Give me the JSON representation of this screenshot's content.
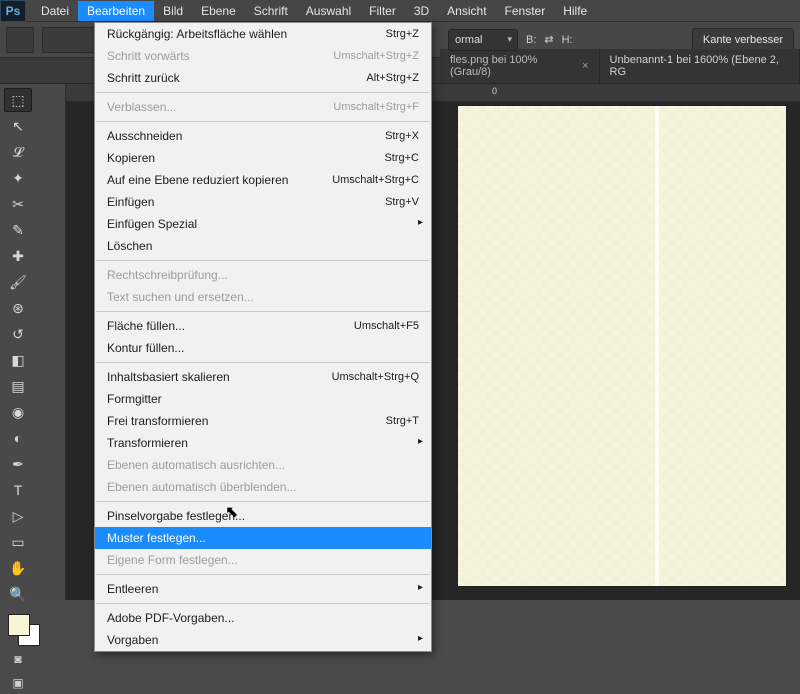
{
  "menubar": [
    "Datei",
    "Bearbeiten",
    "Bild",
    "Ebene",
    "Schrift",
    "Auswahl",
    "Filter",
    "3D",
    "Ansicht",
    "Fenster",
    "Hilfe"
  ],
  "menubar_open_index": 1,
  "options": {
    "style_value": "ormal",
    "b_label": "B:",
    "h_label": "H:",
    "refine_btn": "Kante verbesser"
  },
  "tabs": [
    {
      "label": "fles.png bei 100% (Grau/8)",
      "closable": true
    },
    {
      "label": "Unbenannt-1 bei 1600% (Ebene 2, RG",
      "closable": false
    }
  ],
  "ruler": {
    "tick0": "0"
  },
  "edit_menu": [
    {
      "t": "item",
      "label": "Rückgängig: Arbeitsfläche wählen",
      "shortcut": "Strg+Z"
    },
    {
      "t": "item",
      "label": "Schritt vorwärts",
      "shortcut": "Umschalt+Strg+Z",
      "disabled": true
    },
    {
      "t": "item",
      "label": "Schritt zurück",
      "shortcut": "Alt+Strg+Z"
    },
    {
      "t": "sep"
    },
    {
      "t": "item",
      "label": "Verblassen...",
      "shortcut": "Umschalt+Strg+F",
      "disabled": true
    },
    {
      "t": "sep"
    },
    {
      "t": "item",
      "label": "Ausschneiden",
      "shortcut": "Strg+X"
    },
    {
      "t": "item",
      "label": "Kopieren",
      "shortcut": "Strg+C"
    },
    {
      "t": "item",
      "label": "Auf eine Ebene reduziert kopieren",
      "shortcut": "Umschalt+Strg+C"
    },
    {
      "t": "item",
      "label": "Einfügen",
      "shortcut": "Strg+V"
    },
    {
      "t": "sub",
      "label": "Einfügen Spezial"
    },
    {
      "t": "item",
      "label": "Löschen"
    },
    {
      "t": "sep"
    },
    {
      "t": "item",
      "label": "Rechtschreibprüfung...",
      "disabled": true
    },
    {
      "t": "item",
      "label": "Text suchen und ersetzen...",
      "disabled": true
    },
    {
      "t": "sep"
    },
    {
      "t": "item",
      "label": "Fläche füllen...",
      "shortcut": "Umschalt+F5"
    },
    {
      "t": "item",
      "label": "Kontur füllen..."
    },
    {
      "t": "sep"
    },
    {
      "t": "item",
      "label": "Inhaltsbasiert skalieren",
      "shortcut": "Umschalt+Strg+Q"
    },
    {
      "t": "item",
      "label": "Formgitter"
    },
    {
      "t": "item",
      "label": "Frei transformieren",
      "shortcut": "Strg+T"
    },
    {
      "t": "sub",
      "label": "Transformieren"
    },
    {
      "t": "item",
      "label": "Ebenen automatisch ausrichten...",
      "disabled": true
    },
    {
      "t": "item",
      "label": "Ebenen automatisch überblenden...",
      "disabled": true
    },
    {
      "t": "sep"
    },
    {
      "t": "item",
      "label": "Pinselvorgabe festlegen..."
    },
    {
      "t": "item",
      "label": "Muster festlegen...",
      "highlight": true
    },
    {
      "t": "item",
      "label": "Eigene Form festlegen...",
      "disabled": true
    },
    {
      "t": "sep"
    },
    {
      "t": "sub",
      "label": "Entleeren"
    },
    {
      "t": "sep"
    },
    {
      "t": "item",
      "label": "Adobe PDF-Vorgaben..."
    },
    {
      "t": "sub",
      "label": "Vorgaben"
    }
  ],
  "tools": [
    {
      "name": "marquee-tool",
      "glyph": "⬚",
      "selected": true
    },
    {
      "name": "move-tool",
      "glyph": "↖"
    },
    {
      "name": "lasso-tool",
      "glyph": "𝓛"
    },
    {
      "name": "quick-select-tool",
      "glyph": "✦"
    },
    {
      "name": "crop-tool",
      "glyph": "✂"
    },
    {
      "name": "eyedropper-tool",
      "glyph": "✎"
    },
    {
      "name": "heal-tool",
      "glyph": "✚"
    },
    {
      "name": "brush-tool",
      "glyph": "🖌"
    },
    {
      "name": "stamp-tool",
      "glyph": "⊛"
    },
    {
      "name": "history-brush-tool",
      "glyph": "↺"
    },
    {
      "name": "eraser-tool",
      "glyph": "◧"
    },
    {
      "name": "gradient-tool",
      "glyph": "▤"
    },
    {
      "name": "blur-tool",
      "glyph": "◉"
    },
    {
      "name": "dodge-tool",
      "glyph": "◐"
    },
    {
      "name": "pen-tool",
      "glyph": "✒"
    },
    {
      "name": "type-tool",
      "glyph": "T"
    },
    {
      "name": "path-select-tool",
      "glyph": "▷"
    },
    {
      "name": "shape-tool",
      "glyph": "▭"
    },
    {
      "name": "hand-tool",
      "glyph": "✋"
    },
    {
      "name": "zoom-tool",
      "glyph": "🔍"
    }
  ]
}
